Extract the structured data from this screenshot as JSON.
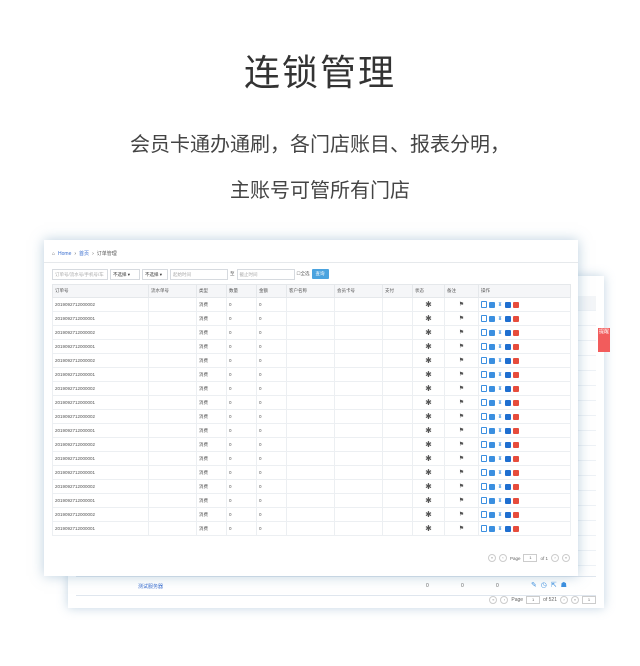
{
  "heading": {
    "title": "连锁管理",
    "line1": "会员卡通办通刷，各门店账目、报表分明，",
    "line2": "主账号可管所有门店"
  },
  "front": {
    "breadcrumb": [
      "Home",
      "首页",
      "订单管理"
    ],
    "toolbar": {
      "search_placeholder": "订单号/流水号/手机号/车",
      "select1": "不选择",
      "select2": "不选择",
      "date_from_placeholder": "起始时间",
      "date_sep": "至",
      "date_to_placeholder": "截止时间",
      "checkbox_label": "全选",
      "query_button": "查询"
    },
    "columns": [
      "订单号",
      "流水单号",
      "类型",
      "数量",
      "金额",
      "客户名称",
      "会员卡号",
      "支付",
      "状态",
      "备注",
      "操作"
    ],
    "rows": [
      {
        "order": "2019092712000002",
        "type": "消费",
        "qty": "0",
        "amount": "0"
      },
      {
        "order": "2019092712000001",
        "type": "消费",
        "qty": "0",
        "amount": "0"
      },
      {
        "order": "2019092712000002",
        "type": "消费",
        "qty": "0",
        "amount": "0"
      },
      {
        "order": "2019092712000001",
        "type": "消费",
        "qty": "0",
        "amount": "0"
      },
      {
        "order": "2019092712000002",
        "type": "消费",
        "qty": "0",
        "amount": "0"
      },
      {
        "order": "2019092712000001",
        "type": "消费",
        "qty": "0",
        "amount": "0"
      },
      {
        "order": "2019092712000002",
        "type": "消费",
        "qty": "0",
        "amount": "0"
      },
      {
        "order": "2019092712000001",
        "type": "消费",
        "qty": "0",
        "amount": "0"
      },
      {
        "order": "2019092712000002",
        "type": "消费",
        "qty": "0",
        "amount": "0"
      },
      {
        "order": "2019092712000001",
        "type": "消费",
        "qty": "0",
        "amount": "0"
      },
      {
        "order": "2019092712000002",
        "type": "消费",
        "qty": "0",
        "amount": "0"
      },
      {
        "order": "2019092712000001",
        "type": "消费",
        "qty": "0",
        "amount": "0"
      },
      {
        "order": "2019092712000001",
        "type": "消费",
        "qty": "0",
        "amount": "0"
      },
      {
        "order": "2019092712000002",
        "type": "消费",
        "qty": "0",
        "amount": "0"
      },
      {
        "order": "2019092712000001",
        "type": "消费",
        "qty": "0",
        "amount": "0"
      },
      {
        "order": "2019092712000002",
        "type": "消费",
        "qty": "0",
        "amount": "0"
      },
      {
        "order": "2019092712000001",
        "type": "消费",
        "qty": "0",
        "amount": "0"
      }
    ],
    "pager": {
      "label": "Page",
      "current": "1",
      "of": "of 1"
    }
  },
  "back": {
    "row_link": "测试服务器",
    "row_vals": [
      "0",
      "0",
      "0"
    ],
    "pager": {
      "label": "Page",
      "current": "1",
      "of": "of 521",
      "size": "1"
    },
    "side_tab": "提醒"
  },
  "colors": {
    "accent": "#4aa3df",
    "status": "#2ecc8a",
    "delete": "#e74c3c",
    "link": "#3b6fd0"
  }
}
